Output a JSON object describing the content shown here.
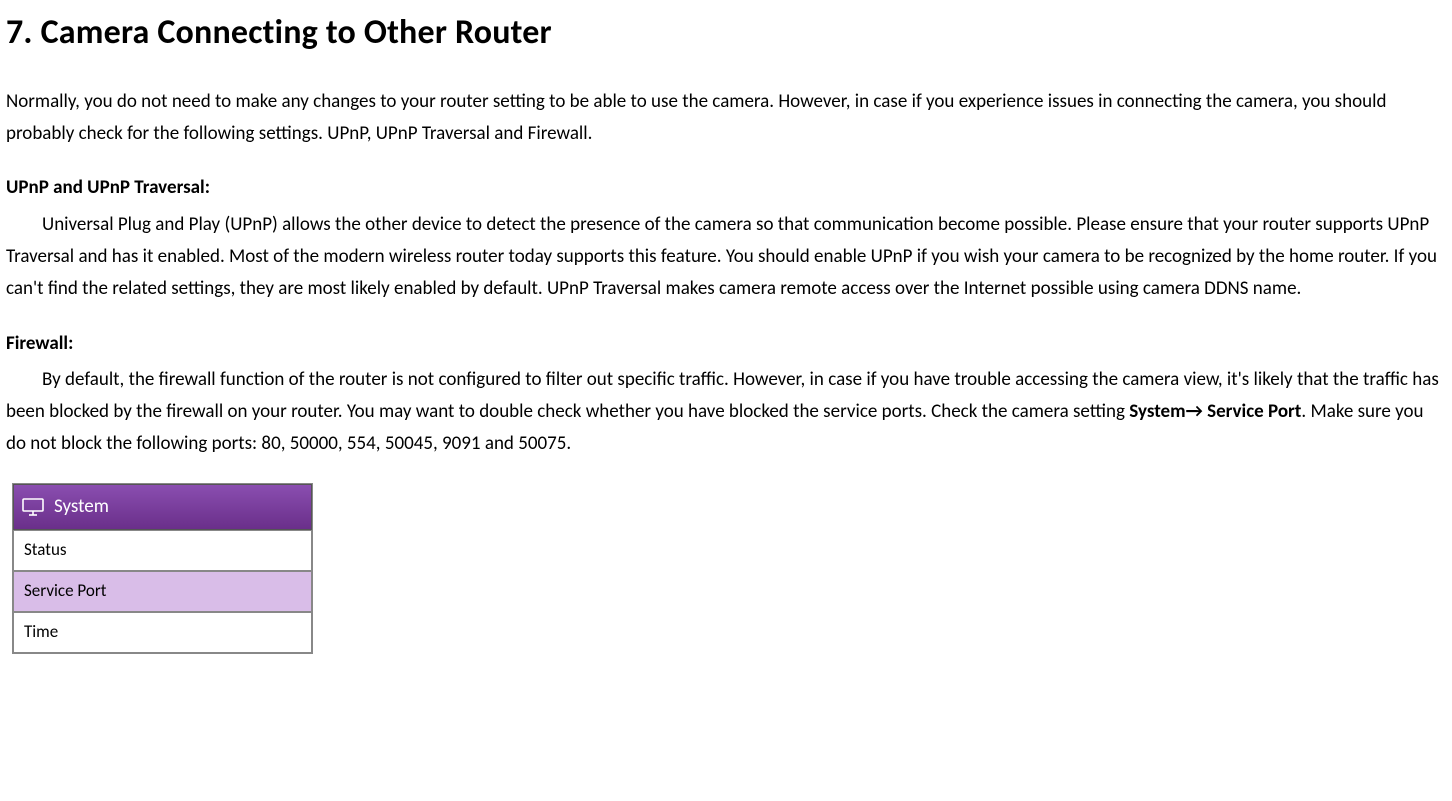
{
  "page": {
    "heading": "7. Camera Connecting to Other Router",
    "intro": "Normally, you do not need to make any changes to your router setting to be able to use the camera. However, in case if you experience issues in connecting the camera, you should probably check for the following settings. UPnP, UPnP Traversal and Firewall.",
    "section1": {
      "title": "UPnP and UPnP Traversal:",
      "body": "Universal Plug and Play (UPnP) allows the other device to detect the presence of the camera so that communication become possible. Please ensure that your router supports UPnP Traversal and has it enabled. Most of the modern wireless router today supports this feature. You should enable UPnP if you wish your camera to be recognized by the home router. If you can't find the related settings, they are most likely enabled by default. UPnP Traversal makes camera remote access over the Internet possible using camera DDNS name."
    },
    "section2": {
      "title": "Firewall:",
      "body_pre": "By default, the firewall function of the router is not configured to filter out specific traffic. However, in case if you have trouble accessing the camera view, it's likely that the traffic has been blocked by the firewall on your router. You may want to double check whether you have blocked the service ports. Check the camera setting ",
      "bold_nav": "System",
      "bold_nav2": "Service Port",
      "body_post": ". Make sure you do not block the following ports: 80, 50000, 554, 50045, 9091 and 50075."
    },
    "menu": {
      "header": "System",
      "items": [
        {
          "label": "Status",
          "selected": false
        },
        {
          "label": "Service Port",
          "selected": true
        },
        {
          "label": "Time",
          "selected": false
        }
      ]
    }
  }
}
